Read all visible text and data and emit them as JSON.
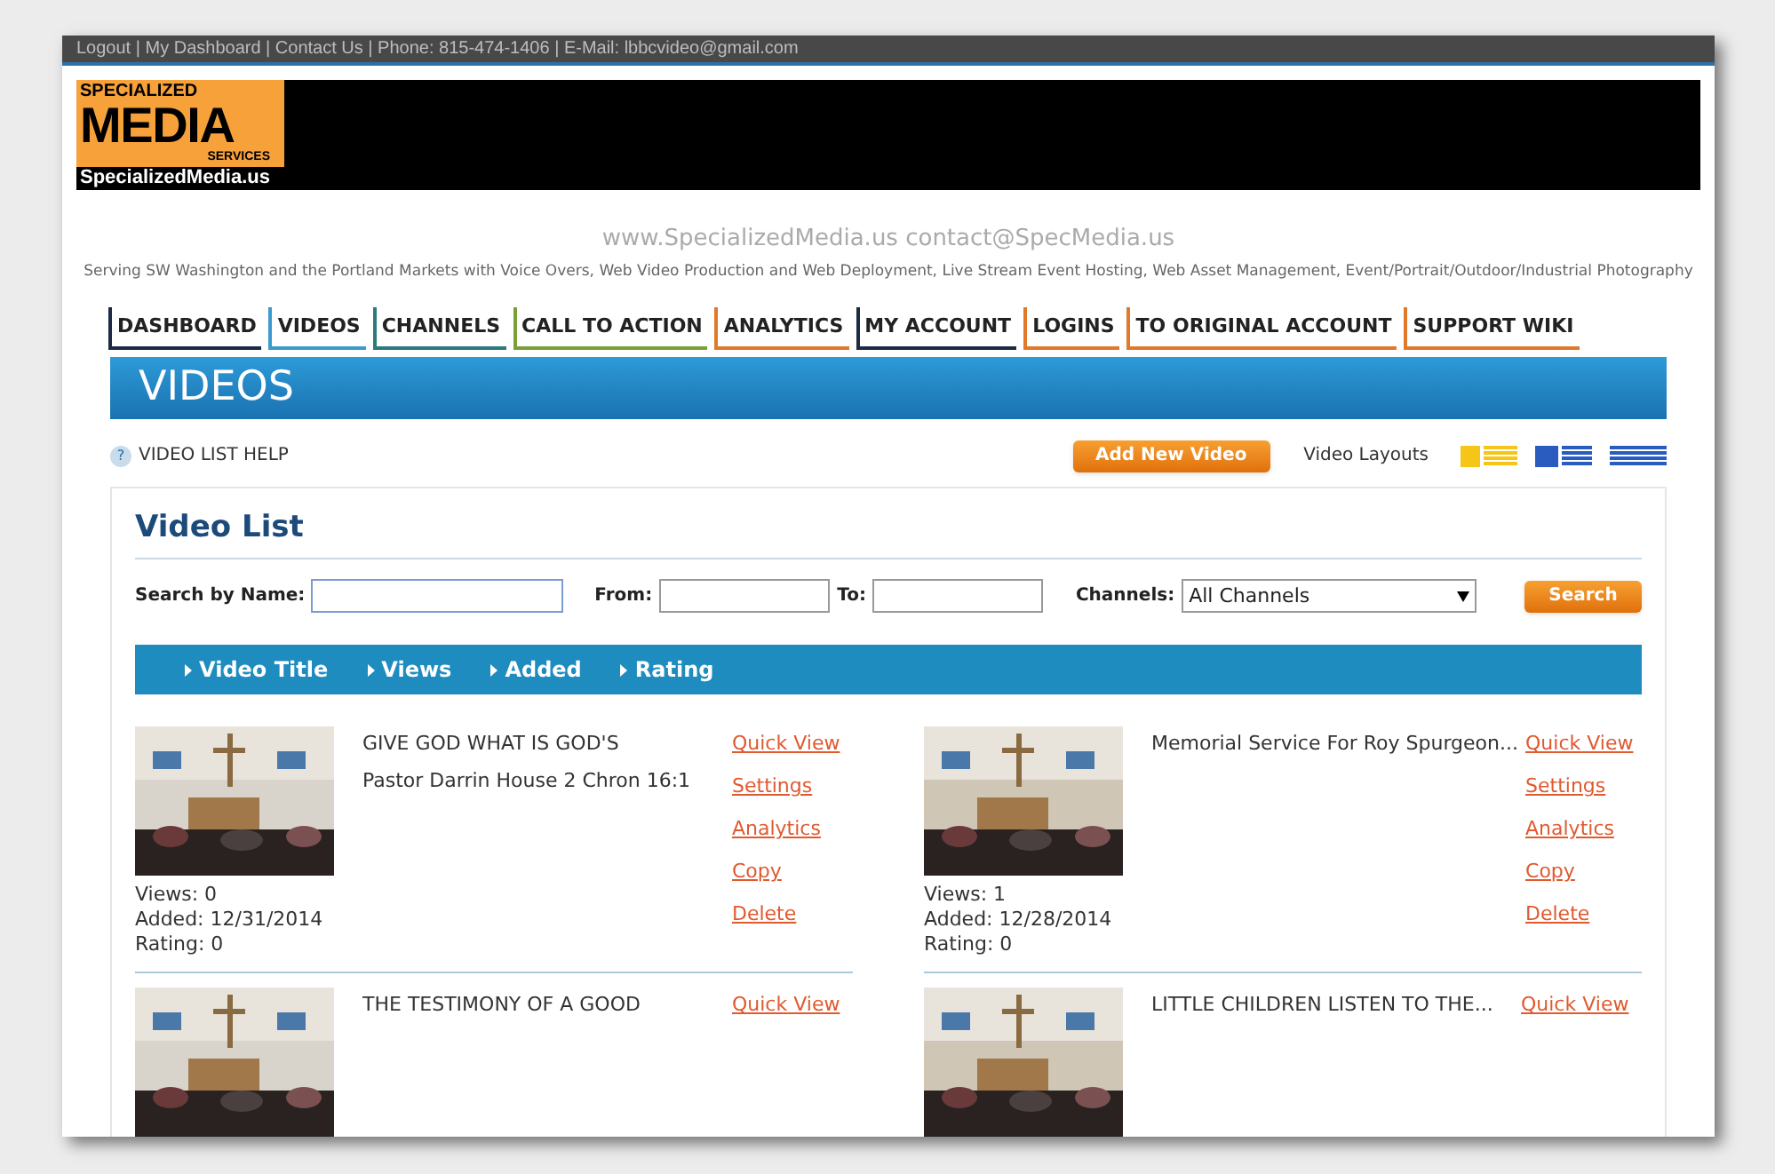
{
  "top_bar": {
    "text": "Logout | My Dashboard | Contact Us | Phone: 815-474-1406 | E-Mail: lbbcvideo@gmail.com"
  },
  "logo": {
    "line_1": "SPECIALIZED",
    "line_2": "MEDIA",
    "line_3": "SERVICES",
    "line_4": "SpecializedMedia.us"
  },
  "tagline": "www.SpecializedMedia.us  contact@SpecMedia.us",
  "services": "Serving SW Washington and the Portland Markets with Voice Overs, Web Video Production and Web Deployment, Live Stream Event Hosting, Web Asset Management, Event/Portrait/Outdoor/Industrial Photography",
  "nav": [
    {
      "label": "DASHBOARD",
      "color": "#1c2a44"
    },
    {
      "label": "VIDEOS",
      "color": "#3a9ad0"
    },
    {
      "label": "CHANNELS",
      "color": "#2a7a80"
    },
    {
      "label": "CALL TO ACTION",
      "color": "#7aa035"
    },
    {
      "label": "ANALYTICS",
      "color": "#e07a2a"
    },
    {
      "label": "MY ACCOUNT",
      "color": "#1c2a44"
    },
    {
      "label": "LOGINS",
      "color": "#e07a2a"
    },
    {
      "label": "TO ORIGINAL ACCOUNT",
      "color": "#e07a2a"
    },
    {
      "label": "SUPPORT WIKI",
      "color": "#e07a2a"
    }
  ],
  "page_title": "VIDEOS",
  "help_link": {
    "icon": "?",
    "label": "VIDEO LIST HELP"
  },
  "add_button": "Add New Video",
  "layouts_label": "Video Layouts",
  "video_list": {
    "title": "Video List",
    "search_label": "Search by Name:",
    "from_label": "From:",
    "to_label": "To:",
    "channels_label": "Channels:",
    "channels_value": "All Channels",
    "search_button": "Search",
    "sort_columns": [
      "Video Title",
      "Views",
      "Added",
      "Rating"
    ],
    "videos": [
      {
        "title": "GIVE GOD WHAT IS GOD'S",
        "subtitle": "Pastor Darrin House 2 Chron 16:1",
        "views": "Views: 0",
        "added": "Added: 12/31/2014",
        "rating": "Rating: 0",
        "actions": [
          "Quick View",
          "Settings",
          "Analytics",
          "Copy",
          "Delete"
        ]
      },
      {
        "title": "Memorial Service For Roy Spurgeon...",
        "views": "Views: 1",
        "added": "Added: 12/28/2014",
        "rating": "Rating: 0",
        "actions": [
          "Quick View",
          "Settings",
          "Analytics",
          "Copy",
          "Delete"
        ]
      },
      {
        "title": "THE TESTIMONY OF A GOOD",
        "actions": [
          "Quick View"
        ]
      },
      {
        "title": "LITTLE CHILDREN LISTEN TO THE...",
        "actions": [
          "Quick View"
        ]
      }
    ]
  }
}
